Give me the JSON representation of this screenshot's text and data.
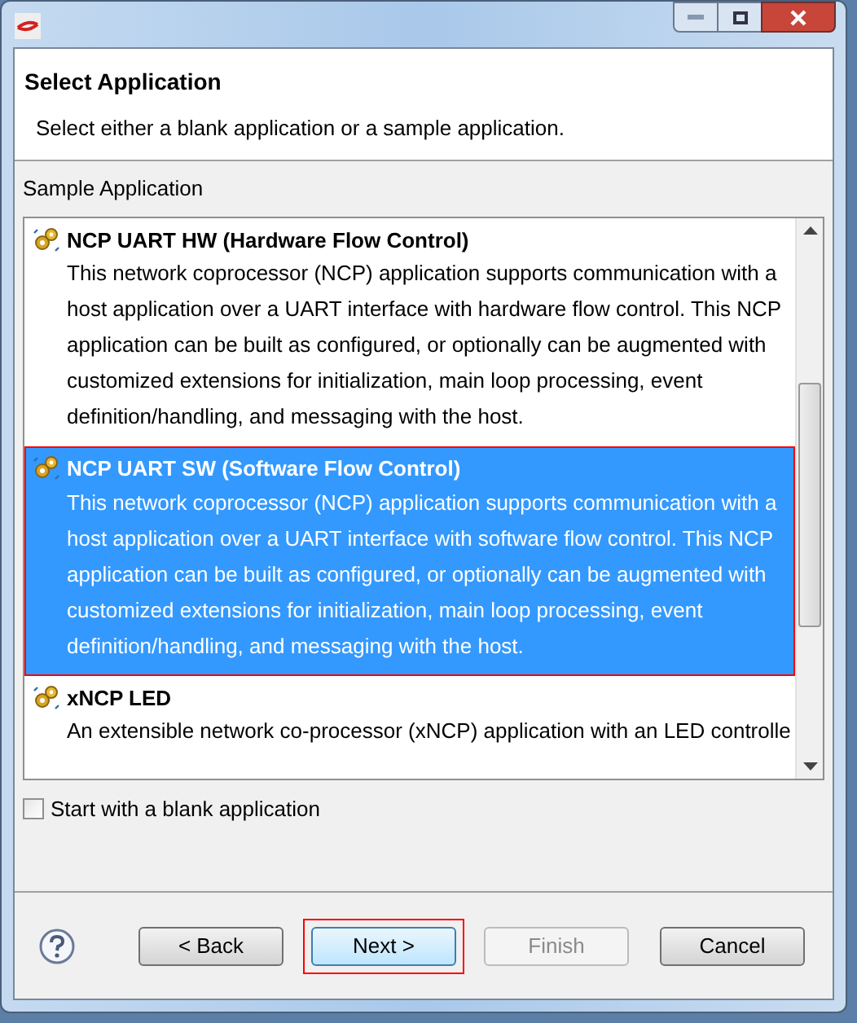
{
  "header": {
    "title": "Select Application",
    "subtitle": "Select either a blank application or a sample application."
  },
  "list_label": "Sample Application",
  "applications": [
    {
      "name": "NCP UART HW (Hardware Flow Control)",
      "description": "This network coprocessor (NCP) application supports communication with a host application over a UART interface with hardware flow control. This NCP application can be built as configured, or optionally can be augmented with customized extensions for initialization, main loop processing, event definition/handling, and messaging with the host.",
      "selected": false,
      "highlighted": false
    },
    {
      "name": "NCP UART SW (Software Flow Control)",
      "description": "This network coprocessor (NCP) application supports communication with a host application over a UART interface with software flow control. This NCP application can be built as configured, or optionally can be augmented with customized extensions for initialization, main loop processing, event definition/handling, and messaging with the host.",
      "selected": true,
      "highlighted": true
    },
    {
      "name": "xNCP LED",
      "description": "An extensible network co-processor (xNCP) application with an LED controlle",
      "selected": false,
      "highlighted": false
    }
  ],
  "blank_option": {
    "label": "Start with a blank application",
    "checked": false
  },
  "buttons": [
    {
      "label": "< Back",
      "disabled": false,
      "focused": false,
      "highlighted": false
    },
    {
      "label": "Next >",
      "disabled": false,
      "focused": true,
      "highlighted": true
    },
    {
      "label": "Finish",
      "disabled": true,
      "focused": false,
      "highlighted": false
    },
    {
      "label": "Cancel",
      "disabled": false,
      "focused": false,
      "highlighted": false
    }
  ]
}
